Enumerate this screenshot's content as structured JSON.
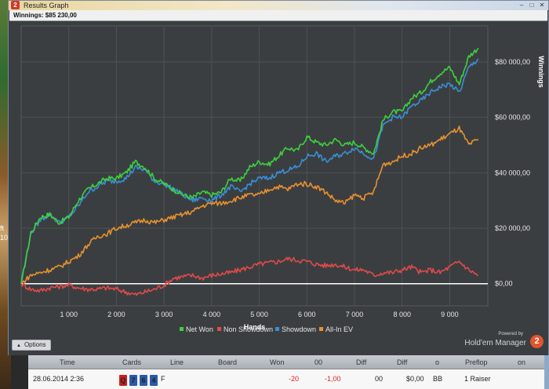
{
  "window": {
    "title": "Results Graph",
    "app_icon": "2",
    "winnings_label": "Winnings: $85 230,00"
  },
  "background": {
    "left_text": [
      "ft",
      "10"
    ]
  },
  "chart_data": {
    "type": "line",
    "xlabel": "Hands",
    "ylabel": "Winnings",
    "xlim": [
      0,
      9800
    ],
    "ylim": [
      -8000,
      93000
    ],
    "x_ticks": [
      1000,
      2000,
      3000,
      4000,
      5000,
      6000,
      7000,
      8000,
      9000
    ],
    "x_tick_labels": [
      "1 000",
      "2 000",
      "3 000",
      "4 000",
      "5 000",
      "6 000",
      "7 000",
      "8 000",
      "9 000"
    ],
    "y_ticks": [
      0,
      20000,
      40000,
      60000,
      80000
    ],
    "y_tick_labels": [
      "$0,00",
      "$20 000,00",
      "$40 000,00",
      "$60 000,00",
      "$80 000,00"
    ],
    "grid": true,
    "legend_position": "bottom",
    "x": [
      0,
      200,
      400,
      600,
      800,
      1000,
      1200,
      1400,
      1600,
      1800,
      2000,
      2200,
      2400,
      2600,
      2800,
      3000,
      3200,
      3400,
      3600,
      3800,
      4000,
      4200,
      4400,
      4600,
      4800,
      5000,
      5200,
      5400,
      5600,
      5800,
      6000,
      6200,
      6400,
      6600,
      6800,
      7000,
      7200,
      7400,
      7600,
      7800,
      8000,
      8200,
      8400,
      8600,
      8800,
      9000,
      9200,
      9400,
      9600
    ],
    "series": [
      {
        "name": "Net Won",
        "color": "#3dd13d",
        "values": [
          0,
          18000,
          24000,
          25000,
          22000,
          24000,
          30000,
          34000,
          36000,
          38000,
          38000,
          40000,
          44000,
          42000,
          38000,
          36000,
          34000,
          32000,
          31000,
          33000,
          32000,
          33000,
          38000,
          37000,
          42000,
          44000,
          43000,
          46000,
          49000,
          48000,
          53000,
          51000,
          50000,
          52000,
          50000,
          51000,
          49000,
          47000,
          59000,
          62000,
          62000,
          67000,
          69000,
          73000,
          76000,
          78000,
          72000,
          82000,
          85000
        ]
      },
      {
        "name": "Non Showdown",
        "color": "#e04a4a",
        "values": [
          0,
          -2000,
          -2500,
          -1500,
          -1000,
          -500,
          -1500,
          -2000,
          -2000,
          -1500,
          -2000,
          -3000,
          -4000,
          -3000,
          -2000,
          -500,
          2000,
          2500,
          3000,
          2000,
          3000,
          3500,
          4000,
          5000,
          6000,
          7000,
          7500,
          8000,
          9000,
          8500,
          8000,
          7000,
          6500,
          7000,
          6000,
          5000,
          5000,
          3000,
          4000,
          4000,
          5000,
          6000,
          4000,
          5000,
          4000,
          6000,
          8000,
          5000,
          3000
        ]
      },
      {
        "name": "Showdown",
        "color": "#3a8ed6",
        "values": [
          0,
          18000,
          23000,
          25000,
          22000,
          24000,
          28000,
          33000,
          35000,
          37000,
          37000,
          38000,
          42000,
          41000,
          37000,
          36000,
          34000,
          32000,
          30000,
          31000,
          30000,
          32000,
          35000,
          33000,
          36000,
          38000,
          38000,
          40000,
          41000,
          42000,
          46000,
          47000,
          44000,
          46000,
          47000,
          49000,
          47000,
          45000,
          57000,
          60000,
          60000,
          64000,
          66000,
          69000,
          71000,
          72000,
          69000,
          78000,
          81000
        ]
      },
      {
        "name": "All-In EV",
        "color": "#e8912e",
        "values": [
          0,
          3000,
          4000,
          5000,
          6000,
          8000,
          10000,
          14000,
          17000,
          18000,
          20000,
          21000,
          22000,
          23000,
          22000,
          23000,
          24000,
          25000,
          26000,
          28000,
          29000,
          29000,
          30000,
          31000,
          32000,
          32000,
          34000,
          35000,
          34000,
          36000,
          36000,
          35000,
          33000,
          30000,
          29000,
          32000,
          31000,
          33000,
          43000,
          44000,
          46000,
          47000,
          49000,
          50000,
          52000,
          54000,
          56000,
          50000,
          52000
        ]
      }
    ],
    "zero_line_color": "#ffffff",
    "background": "#3b3e41",
    "grid_color": "#4d5154"
  },
  "footer": {
    "options_label": "Options",
    "powered_by": "Powered by",
    "brand_name": "Hold'em Manager",
    "brand_logo": "2"
  },
  "table": {
    "headers": [
      "Time",
      "Cards",
      "Line",
      "Board",
      "Won",
      "00",
      "Diff",
      "Diff",
      "o",
      "Preflop",
      "on"
    ],
    "row": {
      "time": "28.06.2014 2:36",
      "cards": [
        "Q",
        "7",
        "6",
        "4"
      ],
      "line": "F",
      "won": "-20",
      "col2": "-1,00",
      "col3": "00",
      "col4": "$0,00",
      "position": "BB",
      "preflop": "1 Raiser"
    }
  }
}
